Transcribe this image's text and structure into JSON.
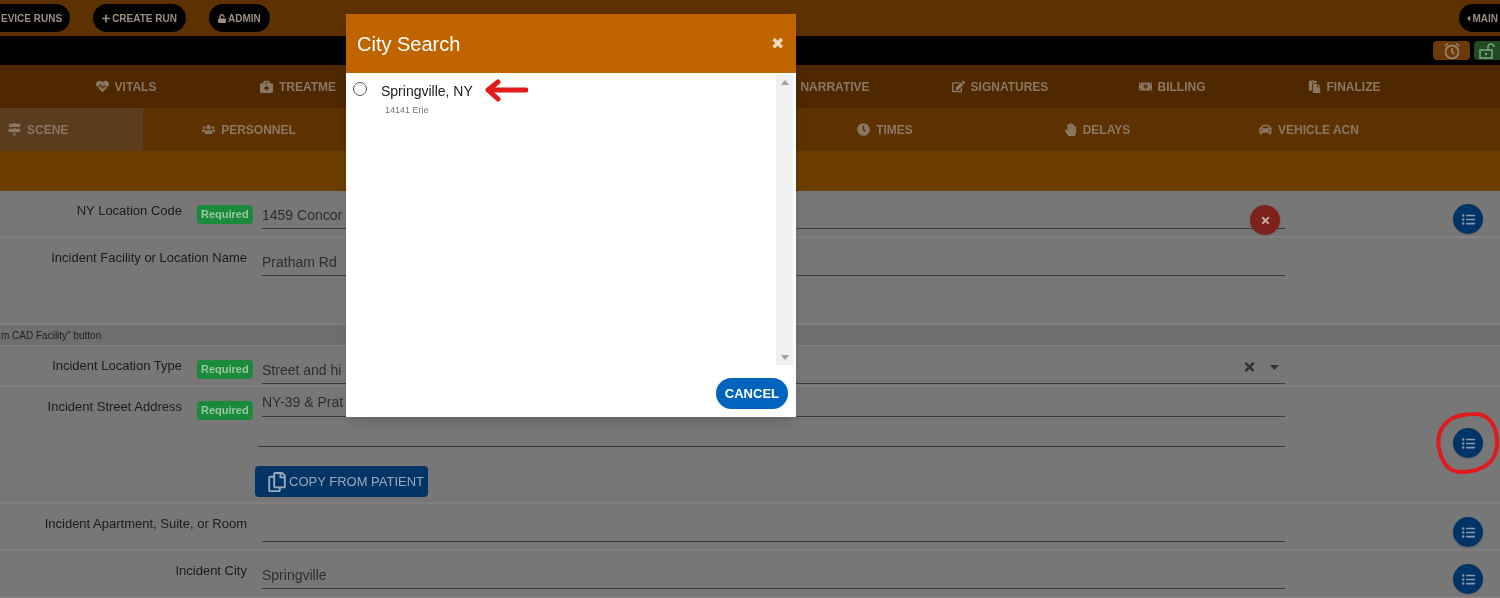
{
  "top_bar": {
    "buttons": [
      {
        "label": "EVICE RUNS"
      },
      {
        "label": "CREATE RUN"
      },
      {
        "label": "ADMIN"
      }
    ],
    "main_button": {
      "label": "MAIN"
    }
  },
  "nav_primary": {
    "left": [
      {
        "label": "VITALS"
      },
      {
        "label": "TREATME"
      }
    ],
    "right": [
      {
        "label": "NARRATIVE"
      },
      {
        "label": "SIGNATURES"
      },
      {
        "label": "BILLING"
      },
      {
        "label": "FINALIZE"
      }
    ]
  },
  "nav_secondary": {
    "left": [
      {
        "label": "SCENE",
        "selected": true
      },
      {
        "label": "PERSONNEL",
        "selected": false
      }
    ],
    "right": [
      {
        "label": "TIMES",
        "selected": false
      },
      {
        "label": "DELAYS",
        "selected": false
      },
      {
        "label": "VEHICLE ACN",
        "selected": false
      }
    ]
  },
  "form": {
    "rows": [
      {
        "kind": "text",
        "label": "NY Location Code",
        "badge": "Required",
        "value": "1459 Concor",
        "clearable": true,
        "list_button": true
      },
      {
        "kind": "textarea",
        "label": "Incident Facility or Location Name",
        "value": "Pratham Rd"
      },
      {
        "kind": "hint",
        "text": "m CAD Facility\" button"
      },
      {
        "kind": "dropdown",
        "label": "Incident Location Type",
        "badge": "Required",
        "value": "Street and hi"
      },
      {
        "kind": "address",
        "label": "Incident Street Address",
        "badge": "Required",
        "value": "NY-39 & Prat",
        "action": "COPY FROM PATIENT",
        "list_button": true
      },
      {
        "kind": "text",
        "label": "Incident Apartment, Suite, or Room",
        "list_button": true
      },
      {
        "kind": "text",
        "label": "Incident City",
        "value": "Springville",
        "list_button": true
      }
    ]
  },
  "dialog": {
    "title": "City Search",
    "close": "✖",
    "results": [
      {
        "name": "Springville, NY",
        "detail": "14141 Erie",
        "selected": false
      }
    ],
    "cancel": "CANCEL"
  }
}
